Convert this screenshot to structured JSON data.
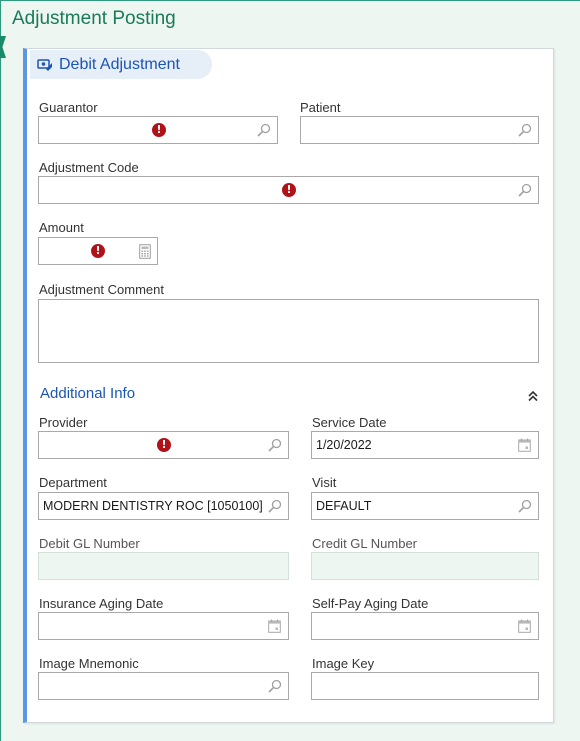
{
  "page": {
    "title": "Adjustment Posting"
  },
  "panel": {
    "title": "Debit Adjustment",
    "fields": {
      "guarantor": {
        "label": "Guarantor",
        "value": ""
      },
      "patient": {
        "label": "Patient",
        "value": ""
      },
      "adjustment_code": {
        "label": "Adjustment Code",
        "value": ""
      },
      "amount": {
        "label": "Amount",
        "value": ""
      },
      "adjustment_comment": {
        "label": "Adjustment Comment",
        "value": ""
      }
    },
    "additional_info": {
      "title": "Additional Info",
      "provider": {
        "label": "Provider",
        "value": ""
      },
      "service_date": {
        "label": "Service Date",
        "value": "1/20/2022"
      },
      "department": {
        "label": "Department",
        "value": "MODERN DENTISTRY ROC [1050100]"
      },
      "visit": {
        "label": "Visit",
        "value": "DEFAULT"
      },
      "debit_gl_number": {
        "label": "Debit GL Number",
        "value": ""
      },
      "credit_gl_number": {
        "label": "Credit GL Number",
        "value": ""
      },
      "insurance_aging_date": {
        "label": "Insurance Aging Date",
        "value": ""
      },
      "self_pay_aging_date": {
        "label": "Self-Pay Aging Date",
        "value": ""
      },
      "image_mnemonic": {
        "label": "Image Mnemonic",
        "value": ""
      },
      "image_key": {
        "label": "Image Key",
        "value": ""
      }
    },
    "required_marker": "!"
  },
  "colors": {
    "page_title": "#1a7a5a",
    "panel_accent": "#5b97e6",
    "header_text": "#1b55b5",
    "required_icon": "#b0121a",
    "readonly_field": "#eef6f2"
  },
  "icons": {
    "header": "money-adjustment-icon",
    "lookup": "search-icon",
    "date": "calendar-icon",
    "amount": "calculator-icon",
    "required": "required-error-icon",
    "collapse": "double-chevron-up-icon"
  }
}
